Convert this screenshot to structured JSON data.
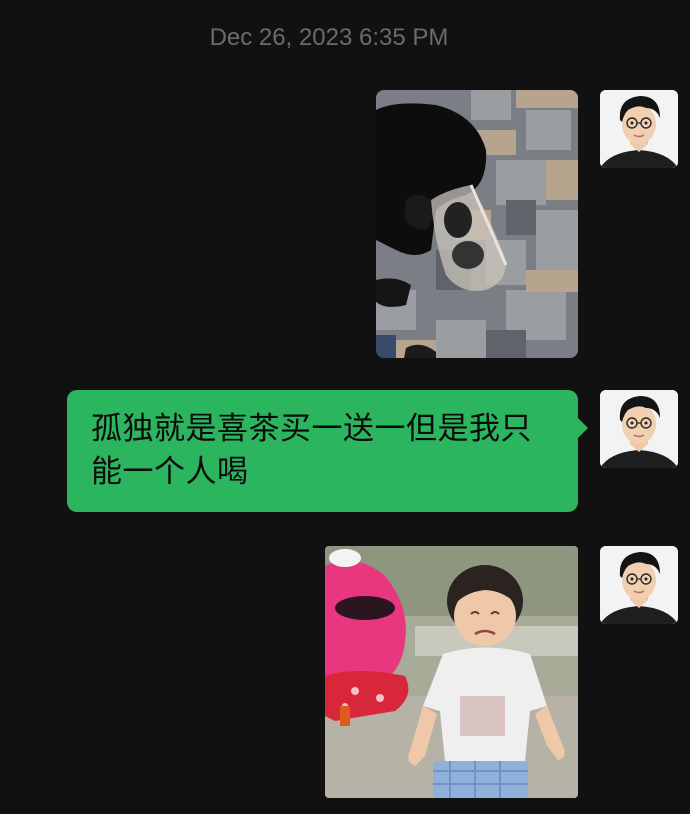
{
  "timestamp": "Dec 26, 2023 6:35 PM",
  "messages": [
    {
      "type": "image",
      "sender": "self",
      "image": "photo-hand-holding-drink-bag"
    },
    {
      "type": "text",
      "sender": "self",
      "text": "孤独就是喜茶买一送一但是我只能一个人喝"
    },
    {
      "type": "image",
      "sender": "self",
      "image": "photo-crying-toddler-sticker"
    }
  ],
  "colors": {
    "background": "#111111",
    "bubble": "#2bb55f",
    "timestamp": "#6b6b6b"
  }
}
